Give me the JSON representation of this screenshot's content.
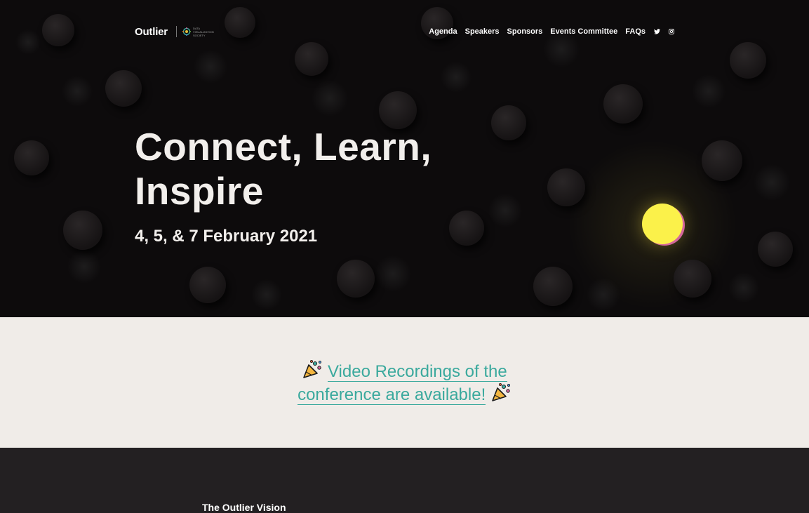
{
  "brand": {
    "logo": "Outlier",
    "partner_logo": "DATA VISUALIZATION SOCIETY"
  },
  "nav": {
    "links": [
      "Agenda",
      "Speakers",
      "Sponsors",
      "Events Committee",
      "FAQs"
    ],
    "icons": [
      "twitter-icon",
      "instagram-icon"
    ]
  },
  "hero": {
    "headline": "Connect, Learn, Inspire",
    "dates": "4, 5, & 7 February 2021"
  },
  "announcement": {
    "text": "Video Recordings of the conference are available!",
    "icon": "party-popper-icon"
  },
  "section": {
    "title": "The Outlier Vision"
  },
  "colors": {
    "accent": "#3aa99d",
    "highlight_dot": "#fbf14a",
    "hero_bg": "#0d0b0c",
    "light_bg": "#f0ece8",
    "dark_bg": "#232022"
  }
}
